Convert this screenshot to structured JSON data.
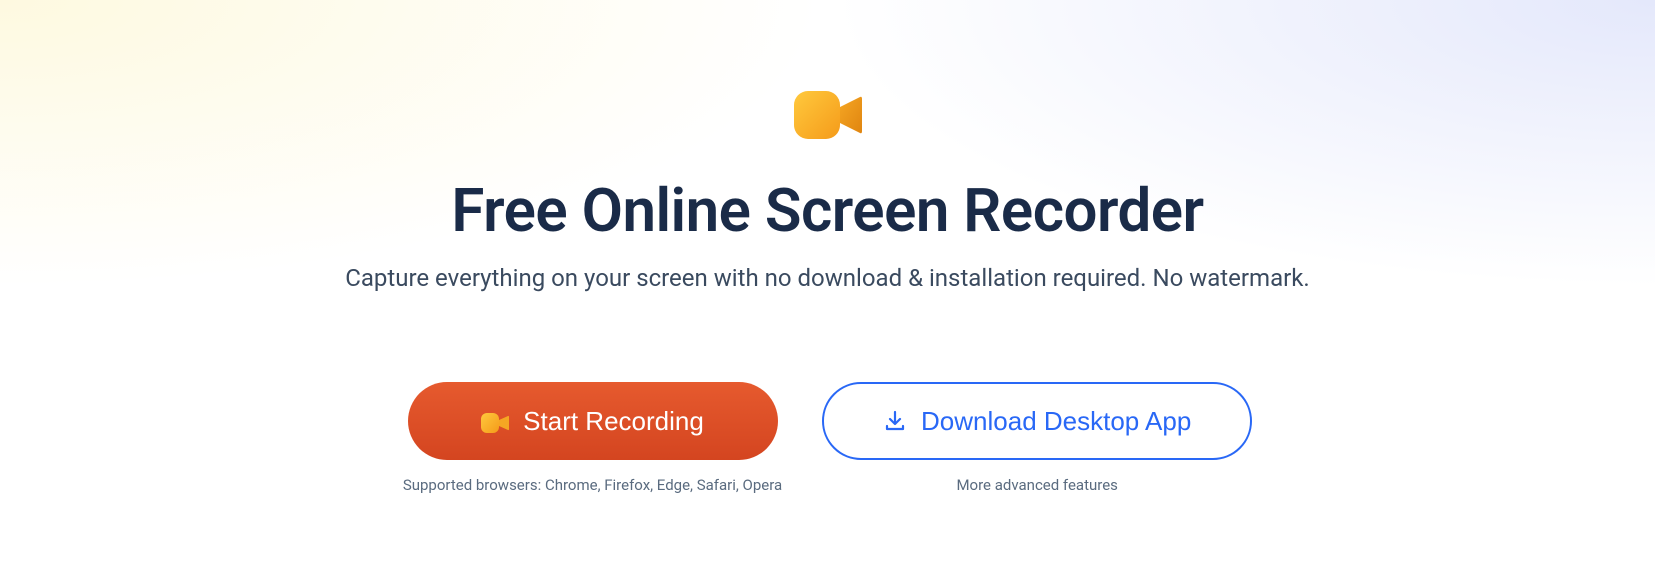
{
  "hero": {
    "title": "Free Online Screen Recorder",
    "subtitle": "Capture everything on your screen with no download & installation required. No watermark."
  },
  "actions": {
    "primary": {
      "label": "Start Recording",
      "caption": "Supported browsers: Chrome, Firefox, Edge, Safari, Opera"
    },
    "secondary": {
      "label": "Download Desktop App",
      "caption": "More advanced features"
    }
  },
  "colors": {
    "primary_button": "#d44520",
    "secondary_button_border": "#2968f6",
    "title_text": "#1a2b48"
  }
}
